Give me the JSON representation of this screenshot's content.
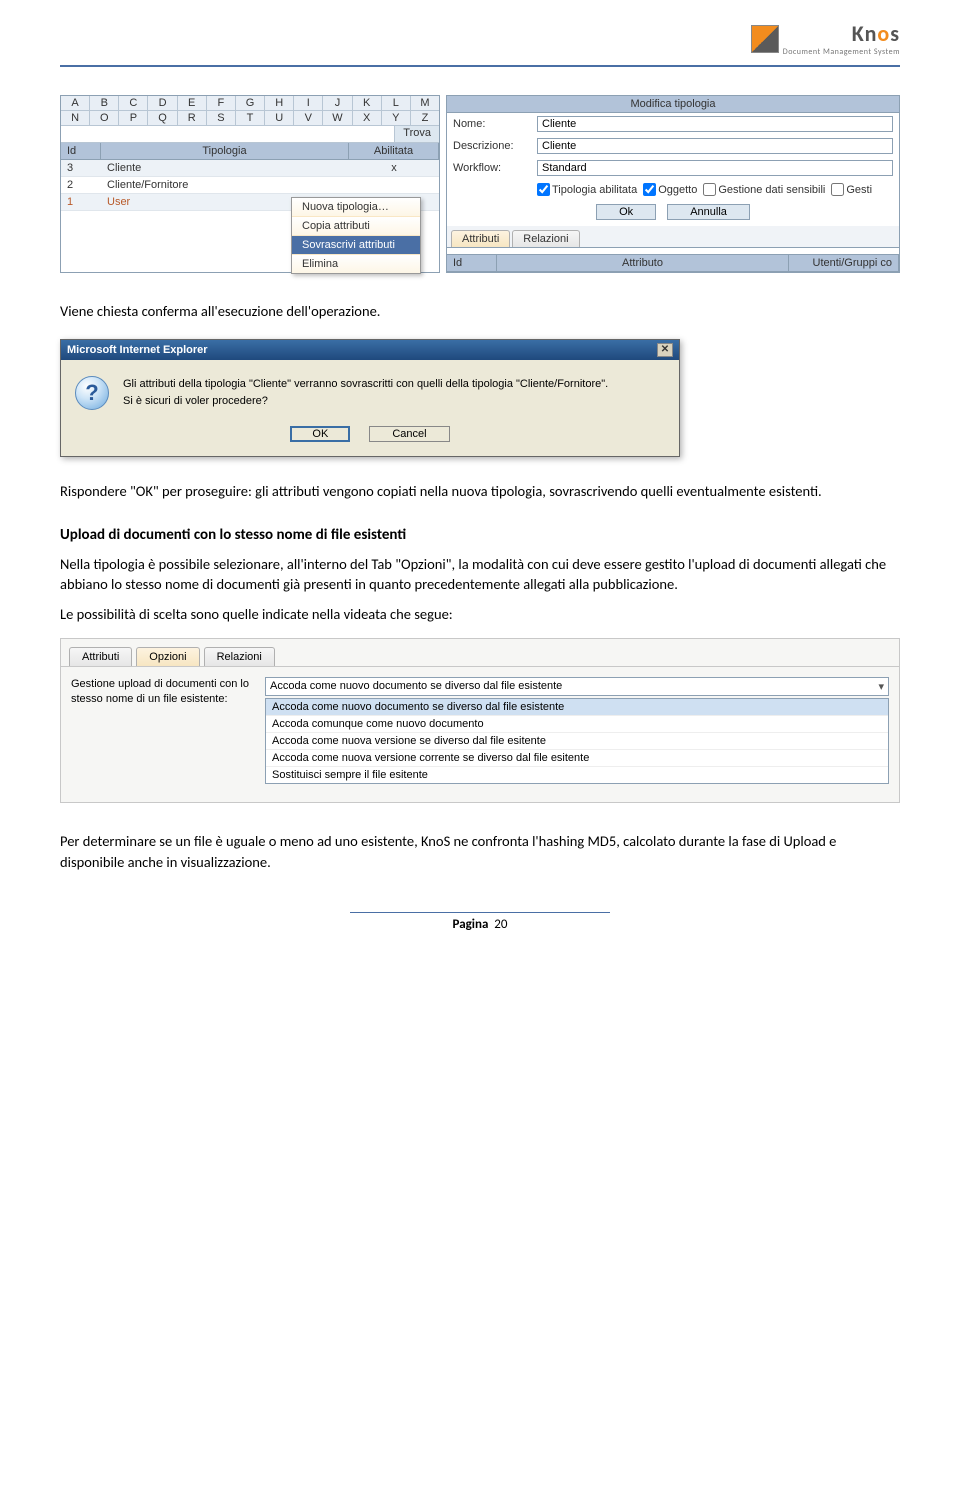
{
  "logo": {
    "name": "Knos",
    "tagline": "Document Management System"
  },
  "left_panel": {
    "alpha1": [
      "A",
      "B",
      "C",
      "D",
      "E",
      "F",
      "G",
      "H",
      "I",
      "J",
      "K",
      "L",
      "M"
    ],
    "alpha2": [
      "N",
      "O",
      "P",
      "Q",
      "R",
      "S",
      "T",
      "U",
      "V",
      "W",
      "X",
      "Y",
      "Z"
    ],
    "search_btn": "Trova",
    "head": {
      "id": "Id",
      "tipo": "Tipologia",
      "ab": "Abilitata"
    },
    "rows": [
      {
        "id": "3",
        "tipo": "Cliente",
        "ab": "x"
      },
      {
        "id": "2",
        "tipo": "Cliente/Fornitore",
        "ab": ""
      },
      {
        "id": "1",
        "tipo": "User",
        "ab": ""
      }
    ],
    "ctx": [
      "Nuova tipologia…",
      "Copia attributi",
      "Sovrascrivi attributi",
      "Elimina"
    ]
  },
  "right_panel": {
    "title": "Modifica tipologia",
    "labels": {
      "nome": "Nome:",
      "desc": "Descrizione:",
      "wf": "Workflow:"
    },
    "values": {
      "nome": "Cliente",
      "desc": "Cliente",
      "wf": "Standard"
    },
    "checks": [
      "Tipologia abilitata",
      "Oggetto",
      "Gestione dati sensibili",
      "Gesti"
    ],
    "checked": [
      true,
      true,
      false,
      false
    ],
    "btns": {
      "ok": "Ok",
      "cancel": "Annulla"
    },
    "tabs": [
      "Attributi",
      "Relazioni"
    ],
    "attr_head": {
      "id": "Id",
      "attr": "Attributo",
      "ug": "Utenti/Gruppi co"
    }
  },
  "para1": "Viene chiesta conferma all'esecuzione dell'operazione.",
  "dialog": {
    "title": "Microsoft Internet Explorer",
    "line1": "Gli attributi della tipologia \"Cliente\" verranno sovrascritti con quelli della tipologia \"Cliente/Fornitore\".",
    "line2": "Si è sicuri di voler procedere?",
    "ok": "OK",
    "cancel": "Cancel"
  },
  "para2": "Rispondere \"OK\" per proseguire: gli attributi vengono copiati nella nuova tipologia, sovrascrivendo quelli eventualmente esistenti.",
  "heading": "Upload di documenti con lo stesso nome di file esistenti",
  "para3": "Nella tipologia è possibile selezionare, all'interno del Tab \"Opzioni\", la modalità con cui deve essere gestito l'upload di documenti allegati che abbiano lo stesso nome di documenti già presenti in quanto precedentemente allegati alla pubblicazione.",
  "para4": "Le possibilità di scelta sono quelle indicate nella videata che segue:",
  "opt_panel": {
    "tabs": [
      "Attributi",
      "Opzioni",
      "Relazioni"
    ],
    "label": "Gestione upload di documenti con lo stesso nome di un file esistente:",
    "selected": "Accoda come nuovo documento se diverso dal file esistente",
    "options": [
      "Accoda come nuovo documento se diverso dal file esistente",
      "Accoda comunque come nuovo documento",
      "Accoda come nuova versione se diverso dal file esitente",
      "Accoda come nuova versione corrente se diverso dal file esitente",
      "Sostituisci sempre il file esitente"
    ]
  },
  "para5": "Per determinare se un file è uguale o meno ad uno esistente, KnoS ne confronta l'hashing MD5, calcolato durante la fase di Upload e disponibile anche in visualizzazione.",
  "footer": {
    "label": "Pagina",
    "num": "20"
  }
}
